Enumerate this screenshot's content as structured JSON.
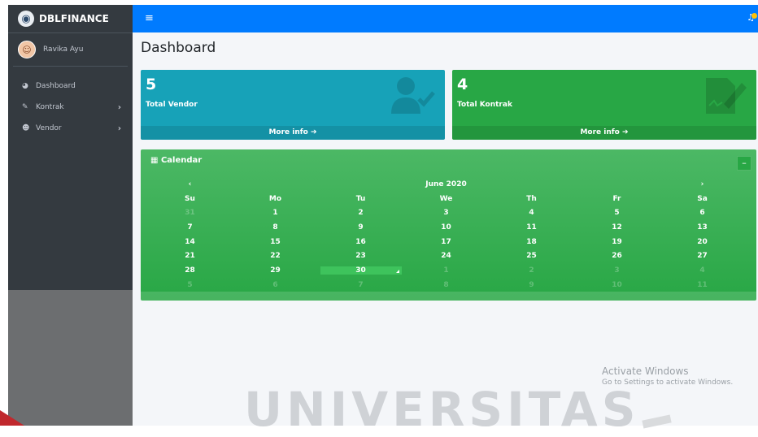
{
  "brand": {
    "name": "DBLFINANCE"
  },
  "user": {
    "name": "Ravika Ayu"
  },
  "sidebar": {
    "items": [
      {
        "label": "Dashboard",
        "icon": "dashboard-icon",
        "has_arrow": false
      },
      {
        "label": "Kontrak",
        "icon": "edit-icon",
        "has_arrow": true,
        "arrow": "›"
      },
      {
        "label": "Vendor",
        "icon": "user-check-icon",
        "has_arrow": true,
        "arrow": "›"
      }
    ]
  },
  "topbar": {
    "menu_icon": "≡",
    "notification_icon": "bell-icon"
  },
  "page": {
    "title": "Dashboard"
  },
  "boxes": {
    "vendor": {
      "count": "5",
      "label": "Total Vendor",
      "more": "More info ➔"
    },
    "kontrak": {
      "count": "4",
      "label": "Total Kontrak",
      "more": "More info ➔"
    }
  },
  "calendar": {
    "title": "Calendar",
    "month": "June 2020",
    "prev": "‹",
    "next": "›",
    "collapse": "–",
    "weekdays": [
      "Su",
      "Mo",
      "Tu",
      "We",
      "Th",
      "Fr",
      "Sa"
    ],
    "weeks": [
      [
        "31",
        "1",
        "2",
        "3",
        "4",
        "5",
        "6"
      ],
      [
        "7",
        "8",
        "9",
        "10",
        "11",
        "12",
        "13"
      ],
      [
        "14",
        "15",
        "16",
        "17",
        "18",
        "19",
        "20"
      ],
      [
        "21",
        "22",
        "23",
        "24",
        "25",
        "26",
        "27"
      ],
      [
        "28",
        "29",
        "30",
        "1",
        "2",
        "3",
        "4"
      ],
      [
        "5",
        "6",
        "7",
        "8",
        "9",
        "10",
        "11"
      ]
    ],
    "selected": "30"
  },
  "overlay": {
    "activate_title": "Activate Windows",
    "activate_sub": "Go to Settings to activate Windows.",
    "watermark": "UNIVERSITAS"
  },
  "colors": {
    "sidebar": "#343a40",
    "topbar": "#007bff",
    "vendor_box": "#17a2b8",
    "kontrak_box": "#28a745",
    "calendar": "#28a745"
  }
}
